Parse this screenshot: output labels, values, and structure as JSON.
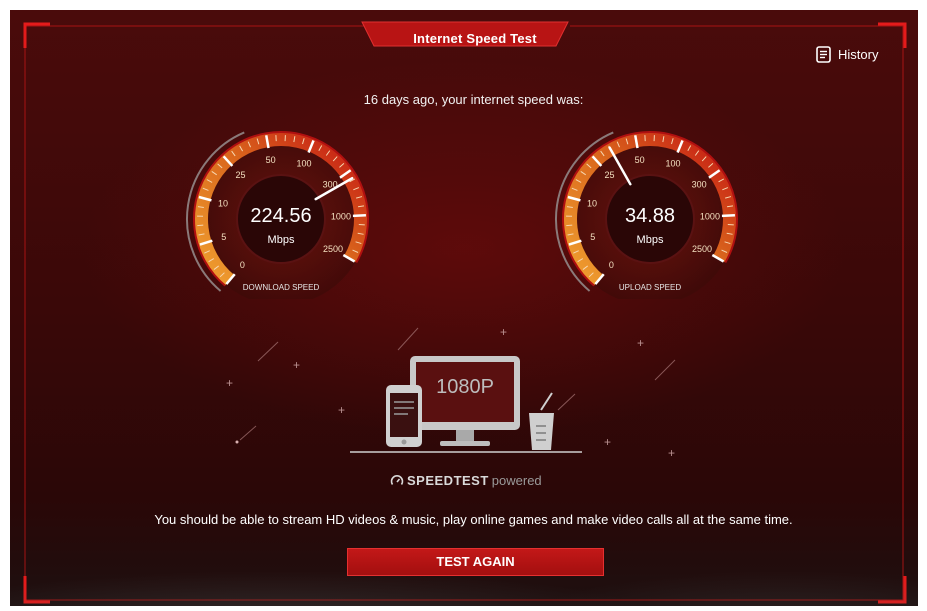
{
  "header": {
    "title": "Internet Speed Test",
    "history_label": "History"
  },
  "result": {
    "summary": "16 days ago, your internet speed was:"
  },
  "gauges": {
    "scale_labels": [
      "0",
      "5",
      "10",
      "25",
      "50",
      "100",
      "300",
      "1000",
      "2500"
    ],
    "download": {
      "value": "224.56",
      "unit": "Mbps",
      "label": "DOWNLOAD SPEED",
      "needle_scale_position": 0.77
    },
    "upload": {
      "value": "34.88",
      "unit": "Mbps",
      "label": "UPLOAD SPEED",
      "needle_scale_position": 0.425
    }
  },
  "illustration": {
    "screen_text": "1080P",
    "brand": "SPEEDTEST",
    "brand_suffix": "powered"
  },
  "message": "You should be able to stream HD videos & music, play online games and make video calls all at the same time.",
  "actions": {
    "test_again": "TEST AGAIN"
  },
  "colors": {
    "accent": "#d11a1a",
    "background": "#3a0808",
    "gauge_orange": "#e8851f"
  },
  "icons": {
    "history": "document-list-icon",
    "speedtest": "speedometer-icon"
  }
}
